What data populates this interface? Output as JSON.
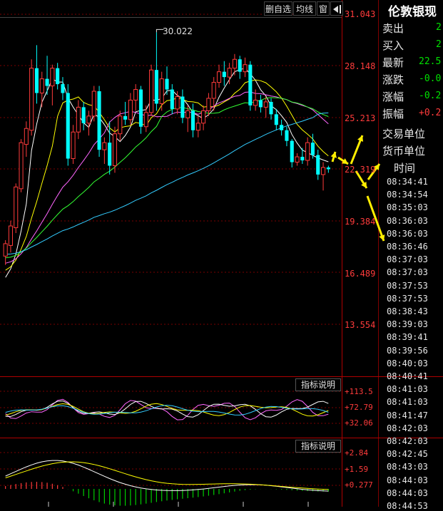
{
  "toolbar": {
    "remove_watchlist": "删自选",
    "ma_lines": "均线",
    "window": "窗",
    "expand_icon": "expand-right-icon"
  },
  "price_axis": [
    "31.043",
    "28.148",
    "25.213",
    "22.319",
    "19.384",
    "16.489",
    "13.554"
  ],
  "peak_annotation": "30.022",
  "indicator1": {
    "button": "指标说明",
    "labels": [
      "+113.5",
      "+72.79",
      "+32.06"
    ]
  },
  "indicator2": {
    "button": "指标说明",
    "labels": [
      "+2.84",
      "+1.59",
      "+0.277"
    ]
  },
  "quote_panel": {
    "title": "伦敦银现",
    "rows": [
      {
        "label": "卖出",
        "value": "2",
        "color": "#00e000"
      },
      {
        "label": "买入",
        "value": "2",
        "color": "#00e000"
      },
      {
        "label": "最新",
        "value": "22.5",
        "color": "#00e000"
      },
      {
        "label": "涨跌",
        "value": "-0.0",
        "color": "#00e000"
      },
      {
        "label": "涨幅",
        "value": "-0.2",
        "color": "#00e000"
      },
      {
        "label": "振幅",
        "value": "+0.2",
        "color": "#ff3b3b"
      }
    ],
    "trade_unit": "交易单位",
    "currency_unit": "货币单位",
    "time_header": "时间"
  },
  "times": [
    "08:34:41",
    "08:34:54",
    "08:35:03",
    "08:36:03",
    "08:36:03",
    "08:36:46",
    "08:37:03",
    "08:37:03",
    "08:37:53",
    "08:37:53",
    "08:38:43",
    "08:39:03",
    "08:39:41",
    "08:39:56",
    "08:40:03",
    "08:40:41",
    "08:41:03",
    "08:41:03",
    "08:41:47",
    "08:42:03",
    "08:42:03",
    "08:42:45",
    "08:43:03",
    "08:44:03",
    "08:44:03",
    "08:44:53"
  ],
  "colors": {
    "up": "#ff3b3b",
    "down": "#00ffff",
    "grid": "#7a0000",
    "border": "#b00000"
  },
  "chart_data": {
    "type": "candlestick",
    "y_ticks": [
      31.043,
      28.148,
      25.213,
      22.319,
      19.384,
      16.489,
      13.554
    ],
    "ylim": [
      13.554,
      31.043
    ],
    "candles": [
      {
        "o": 17.4,
        "h": 18.3,
        "l": 16.9,
        "c": 18.1
      },
      {
        "o": 18.0,
        "h": 19.4,
        "l": 17.6,
        "c": 19.1
      },
      {
        "o": 19.0,
        "h": 21.5,
        "l": 18.7,
        "c": 21.3
      },
      {
        "o": 21.2,
        "h": 24.0,
        "l": 21.0,
        "c": 23.8
      },
      {
        "o": 23.7,
        "h": 25.0,
        "l": 23.0,
        "c": 24.6
      },
      {
        "o": 24.5,
        "h": 28.5,
        "l": 24.2,
        "c": 28.0
      },
      {
        "o": 28.0,
        "h": 29.3,
        "l": 26.0,
        "c": 26.6
      },
      {
        "o": 26.6,
        "h": 27.8,
        "l": 25.8,
        "c": 27.4
      },
      {
        "o": 27.4,
        "h": 28.7,
        "l": 26.5,
        "c": 27.0
      },
      {
        "o": 27.0,
        "h": 28.2,
        "l": 25.9,
        "c": 28.0
      },
      {
        "o": 28.0,
        "h": 28.3,
        "l": 26.8,
        "c": 27.1
      },
      {
        "o": 27.1,
        "h": 27.5,
        "l": 26.2,
        "c": 26.6
      },
      {
        "o": 26.6,
        "h": 27.1,
        "l": 22.5,
        "c": 22.9
      },
      {
        "o": 22.9,
        "h": 24.8,
        "l": 22.6,
        "c": 24.4
      },
      {
        "o": 24.4,
        "h": 26.2,
        "l": 24.0,
        "c": 25.8
      },
      {
        "o": 25.8,
        "h": 26.1,
        "l": 24.5,
        "c": 24.9
      },
      {
        "o": 24.9,
        "h": 25.6,
        "l": 24.2,
        "c": 25.3
      },
      {
        "o": 25.3,
        "h": 27.0,
        "l": 25.0,
        "c": 26.7
      },
      {
        "o": 26.7,
        "h": 27.0,
        "l": 23.0,
        "c": 23.4
      },
      {
        "o": 23.4,
        "h": 24.1,
        "l": 22.6,
        "c": 23.8
      },
      {
        "o": 23.8,
        "h": 25.0,
        "l": 22.0,
        "c": 22.5
      },
      {
        "o": 22.5,
        "h": 24.7,
        "l": 22.1,
        "c": 24.3
      },
      {
        "o": 24.3,
        "h": 25.6,
        "l": 23.9,
        "c": 25.3
      },
      {
        "o": 25.3,
        "h": 26.1,
        "l": 24.8,
        "c": 25.1
      },
      {
        "o": 25.1,
        "h": 26.6,
        "l": 24.8,
        "c": 26.2
      },
      {
        "o": 26.2,
        "h": 27.1,
        "l": 25.6,
        "c": 26.8
      },
      {
        "o": 26.8,
        "h": 27.0,
        "l": 24.3,
        "c": 24.7
      },
      {
        "o": 24.7,
        "h": 25.9,
        "l": 24.4,
        "c": 25.5
      },
      {
        "o": 25.5,
        "h": 28.2,
        "l": 25.3,
        "c": 27.9
      },
      {
        "o": 27.9,
        "h": 30.022,
        "l": 25.6,
        "c": 26.0
      },
      {
        "o": 26.0,
        "h": 27.8,
        "l": 25.6,
        "c": 27.4
      },
      {
        "o": 27.4,
        "h": 28.1,
        "l": 26.5,
        "c": 26.8
      },
      {
        "o": 26.8,
        "h": 27.1,
        "l": 25.4,
        "c": 25.7
      },
      {
        "o": 25.7,
        "h": 26.7,
        "l": 25.4,
        "c": 26.4
      },
      {
        "o": 26.4,
        "h": 26.8,
        "l": 24.9,
        "c": 25.2
      },
      {
        "o": 25.2,
        "h": 25.9,
        "l": 24.4,
        "c": 25.6
      },
      {
        "o": 25.6,
        "h": 26.0,
        "l": 24.1,
        "c": 24.5
      },
      {
        "o": 24.5,
        "h": 25.3,
        "l": 24.1,
        "c": 24.9
      },
      {
        "o": 24.9,
        "h": 25.9,
        "l": 24.5,
        "c": 25.6
      },
      {
        "o": 25.6,
        "h": 26.6,
        "l": 25.3,
        "c": 26.3
      },
      {
        "o": 26.3,
        "h": 27.5,
        "l": 25.6,
        "c": 27.2
      },
      {
        "o": 27.2,
        "h": 28.2,
        "l": 26.9,
        "c": 27.8
      },
      {
        "o": 27.8,
        "h": 28.4,
        "l": 27.0,
        "c": 27.5
      },
      {
        "o": 27.5,
        "h": 28.3,
        "l": 27.1,
        "c": 28.0
      },
      {
        "o": 28.0,
        "h": 28.8,
        "l": 27.6,
        "c": 28.5
      },
      {
        "o": 28.5,
        "h": 28.7,
        "l": 27.4,
        "c": 27.8
      },
      {
        "o": 27.8,
        "h": 28.6,
        "l": 27.5,
        "c": 28.2
      },
      {
        "o": 28.2,
        "h": 28.4,
        "l": 25.6,
        "c": 25.9
      },
      {
        "o": 25.9,
        "h": 26.8,
        "l": 25.6,
        "c": 26.2
      },
      {
        "o": 26.2,
        "h": 26.5,
        "l": 25.5,
        "c": 25.8
      },
      {
        "o": 25.8,
        "h": 26.4,
        "l": 25.2,
        "c": 26.1
      },
      {
        "o": 26.1,
        "h": 26.3,
        "l": 25.1,
        "c": 25.4
      },
      {
        "o": 25.4,
        "h": 25.7,
        "l": 24.5,
        "c": 24.8
      },
      {
        "o": 24.8,
        "h": 25.1,
        "l": 24.2,
        "c": 24.5
      },
      {
        "o": 24.5,
        "h": 24.7,
        "l": 23.6,
        "c": 23.9
      },
      {
        "o": 23.9,
        "h": 24.0,
        "l": 22.4,
        "c": 22.7
      },
      {
        "o": 22.7,
        "h": 23.2,
        "l": 22.5,
        "c": 23.0
      },
      {
        "o": 23.0,
        "h": 23.5,
        "l": 22.6,
        "c": 22.8
      },
      {
        "o": 22.8,
        "h": 24.1,
        "l": 22.5,
        "c": 23.8
      },
      {
        "o": 23.8,
        "h": 24.3,
        "l": 22.9,
        "c": 23.1
      },
      {
        "o": 23.1,
        "h": 23.4,
        "l": 21.7,
        "c": 22.0
      },
      {
        "o": 22.0,
        "h": 22.7,
        "l": 21.1,
        "c": 22.4
      },
      {
        "o": 22.4,
        "h": 22.5,
        "l": 22.1,
        "c": 22.3
      }
    ]
  }
}
